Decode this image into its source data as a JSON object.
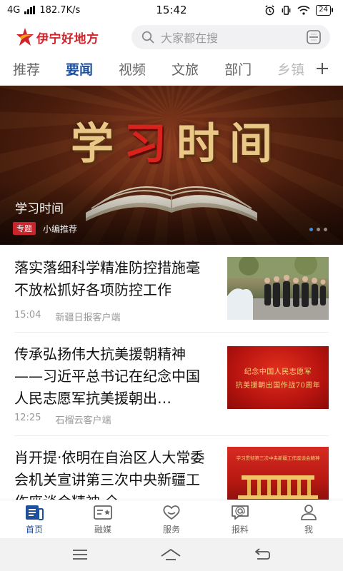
{
  "status_bar": {
    "network": "4G",
    "speed": "182.7K/s",
    "time": "15:42",
    "battery": "24"
  },
  "header": {
    "app_name": "伊宁好地方",
    "search_placeholder": "大家都在搜",
    "icons": [
      "logo-icon",
      "search-icon",
      "scan-icon"
    ],
    "brand_color": "#d2232a"
  },
  "tabs": {
    "items": [
      "推荐",
      "要闻",
      "视频",
      "文旅",
      "部门",
      "乡镇"
    ],
    "active_index": 1,
    "active_color": "#1e4f9c",
    "add_icon": "plus-icon"
  },
  "banner": {
    "artwork_text": [
      "学",
      "习",
      "时",
      "间"
    ],
    "caption": "学习时间",
    "tag": "专题",
    "source": "小编推荐",
    "slide_count": 3,
    "active_slide": 0
  },
  "news": [
    {
      "title": "落实落细科学精准防控措施毫不放松抓好各项防控工作",
      "time": "15:04",
      "source": "新疆日报客户端"
    },
    {
      "title": "传承弘扬伟大抗美援朝精神——习近平总书记在纪念中国人民志愿军抗美援朝出…",
      "time": "12:25",
      "source": "石榴云客户端",
      "thumb_text": [
        "纪念中国人民志愿军",
        "抗美援朝出国作战70周年"
      ]
    },
    {
      "title": "肖开提·依明在自治区人大常委会机关宣讲第三次中央新疆工作座谈会精神 全…",
      "thumb_text": "学习贯彻第三次中央新疆工作座谈会精神"
    }
  ],
  "bottom_nav": {
    "items": [
      {
        "label": "首页",
        "icon": "home-news-icon"
      },
      {
        "label": "融媒",
        "icon": "media-card-icon"
      },
      {
        "label": "服务",
        "icon": "service-heart-icon"
      },
      {
        "label": "报料",
        "icon": "report-chat-icon"
      },
      {
        "label": "我",
        "icon": "profile-icon"
      }
    ],
    "active_index": 0
  },
  "system_nav": [
    "menu-icon",
    "home-icon",
    "back-icon"
  ]
}
